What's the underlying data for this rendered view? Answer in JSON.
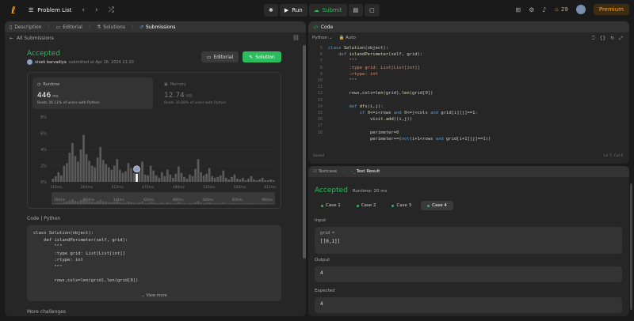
{
  "topbar": {
    "list_title": "Problem List",
    "run_label": "Run",
    "submit_label": "Submit",
    "streak": "29",
    "premium_label": "Premium"
  },
  "left": {
    "tabs": [
      {
        "label": "Description",
        "icon": "document-icon"
      },
      {
        "label": "Editorial",
        "icon": "book-icon"
      },
      {
        "label": "Solutions",
        "icon": "flask-icon"
      },
      {
        "label": "Submissions",
        "icon": "history-icon"
      }
    ],
    "back_label": "All Submissions",
    "status": "Accepted",
    "username": "vivek barvadiya",
    "submitted_text": "submitted at Apr 16, 2024 21:20",
    "editorial_btn": "Editorial",
    "solution_btn": "Solution",
    "runtime": {
      "label": "Runtime",
      "value": "446",
      "unit": "ms",
      "beats": "Beats 36.11% of users with Python"
    },
    "memory": {
      "label": "Memory",
      "value": "12.74",
      "unit": "MB",
      "beats": "Beats 30.88% of users with Python"
    },
    "code_label": "Code | Python",
    "code_lines": [
      "class Solution(object):",
      "    def islandPerimeter(self, grid):",
      "        \"\"\"",
      "        :type grid: List[List[int]]",
      "        :rtype: int",
      "        \"\"\"",
      "",
      "        rows,cols=len(grid),len(grid[0])"
    ],
    "view_more": "View more",
    "more_challenges": "More challenges"
  },
  "chart_data": {
    "type": "bar",
    "y_ticks": [
      "8%",
      "6%",
      "4%",
      "2%",
      "0%"
    ],
    "x_ticks": [
      "216ms",
      "264ms",
      "312ms",
      "470ms",
      "480ms",
      "516ms",
      "564ms",
      "612ms"
    ],
    "mini_ticks": [
      "204ms",
      "264ms",
      "324ms",
      "420ms",
      "480ms",
      "540ms",
      "600ms",
      "660ms"
    ],
    "ylim": [
      0,
      8
    ],
    "values": [
      0.4,
      0.7,
      1.2,
      0.8,
      2.0,
      2.3,
      3.6,
      4.8,
      3.2,
      2.5,
      4.0,
      5.8,
      3.4,
      2.6,
      2.0,
      1.8,
      3.0,
      4.3,
      2.7,
      2.2,
      1.8,
      1.5,
      2.0,
      2.8,
      1.5,
      1.1,
      1.3,
      2.3,
      1.7,
      1.1,
      1.0,
      1.6,
      2.5,
      0.9,
      0.8,
      2.0,
      1.4,
      0.8,
      0.5,
      1.2,
      0.7,
      1.5,
      0.9,
      0.5,
      1.0,
      1.9,
      1.1,
      0.6,
      0.4,
      0.9,
      0.7,
      1.6,
      2.8,
      1.2,
      0.8,
      1.0,
      1.7,
      0.7,
      0.5,
      0.6,
      0.8,
      1.4,
      0.5,
      0.3,
      0.6,
      0.9,
      0.4,
      0.3,
      0.5,
      0.2,
      0.4,
      0.7,
      0.3,
      0.2,
      0.3,
      0.5,
      0.2,
      0.2,
      0.3,
      0.2
    ],
    "highlight_index": 30,
    "bar_color": "#5a5a5a",
    "highlight_color": "#ffffff"
  },
  "code_panel": {
    "title": "Code",
    "lang": "Python",
    "auto": "Auto",
    "saved": "Saved",
    "cursor": "Ln 7, Col 4",
    "gutter": [
      "5",
      "6",
      "7",
      "8",
      "9",
      "10",
      "11",
      "12",
      "13",
      "14",
      "15",
      "16",
      "17",
      "18"
    ],
    "lines": [
      "class Solution(object):",
      "    def islandPerimeter(self, grid):",
      "        \"\"\"",
      "        :type grid: List[List[int]]",
      "        :rtype: int",
      "        \"\"\"",
      "",
      "        rows,cols=len(grid),len(grid[0])",
      "",
      "        def dfs(i,j):",
      "            if 0<=i<rows and 0<=j<cols and grid[i][j]==1:",
      "                visit.add((i,j))",
      "",
      "                perimeter=0",
      "                perimeter+=(not(i+1<rows and grid[i+1][j]==1))"
    ]
  },
  "result": {
    "tab_testcase": "Testcase",
    "tab_result": "Test Result",
    "status": "Accepted",
    "runtime": "Runtime: 20 ms",
    "cases": [
      "Case 1",
      "Case 2",
      "Case 3",
      "Case 4"
    ],
    "active_case": 3,
    "input_label": "Input",
    "input_var": "grid =",
    "input_value": "[[0,1]]",
    "output_label": "Output",
    "output_value": "4",
    "expected_label": "Expected",
    "expected_value": "4"
  }
}
